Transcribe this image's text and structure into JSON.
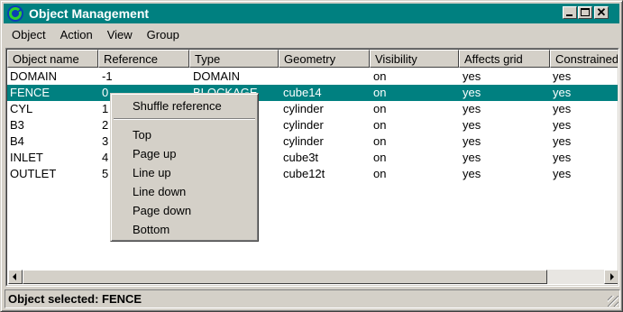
{
  "window": {
    "title": "Object Management",
    "controls": [
      "minimize",
      "maximize",
      "close"
    ],
    "close_glyph": "✕"
  },
  "menubar": [
    "Object",
    "Action",
    "View",
    "Group"
  ],
  "table": {
    "columns": [
      "Object name",
      "Reference",
      "Type",
      "Geometry",
      "Visibility",
      "Affects grid",
      "Constrained"
    ],
    "rows": [
      [
        "DOMAIN",
        "-1",
        "DOMAIN",
        "",
        "on",
        "yes",
        "yes"
      ],
      [
        "FENCE",
        "0",
        "BLOCKAGE",
        "cube14",
        "on",
        "yes",
        "yes"
      ],
      [
        "CYL",
        "1",
        "",
        "cylinder",
        "on",
        "yes",
        "yes"
      ],
      [
        "B3",
        "2",
        "",
        "cylinder",
        "on",
        "yes",
        "yes"
      ],
      [
        "B4",
        "3",
        "",
        "cylinder",
        "on",
        "yes",
        "yes"
      ],
      [
        "INLET",
        "4",
        "",
        "cube3t",
        "on",
        "yes",
        "yes"
      ],
      [
        "OUTLET",
        "5",
        "",
        "cube12t",
        "on",
        "yes",
        "yes"
      ]
    ],
    "selected_row": 1
  },
  "context_menu": {
    "items": [
      "Shuffle reference",
      "Top",
      "Page up",
      "Line up",
      "Line down",
      "Page down",
      "Bottom"
    ]
  },
  "status": {
    "text": "Object selected: FENCE"
  },
  "colors": {
    "titlebar": "#008080",
    "selection": "#008080",
    "face": "#d4d0c8"
  }
}
